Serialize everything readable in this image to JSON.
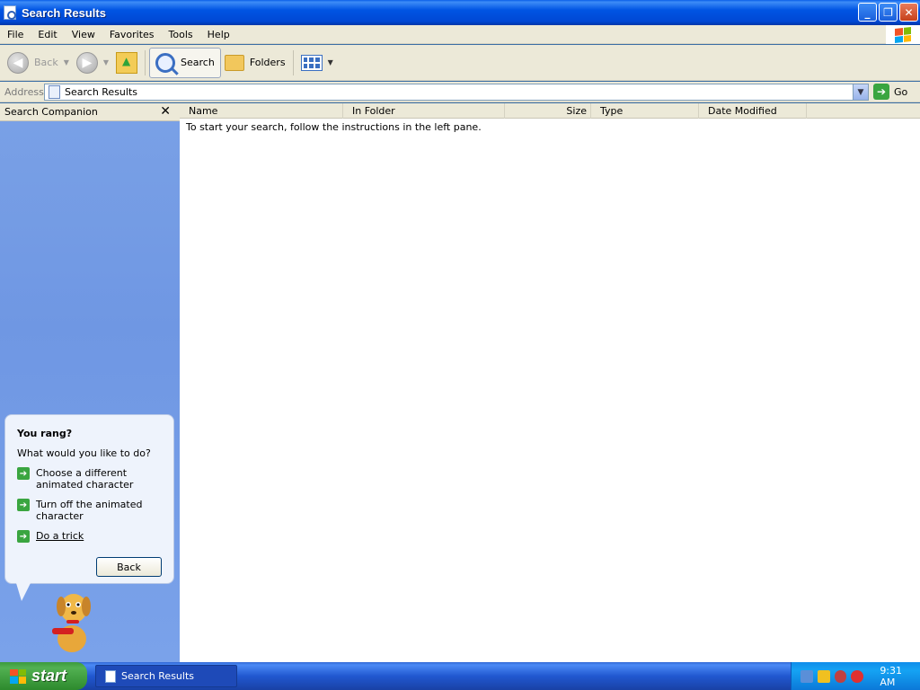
{
  "window": {
    "title": "Search Results"
  },
  "menu": [
    "File",
    "Edit",
    "View",
    "Favorites",
    "Tools",
    "Help"
  ],
  "toolbar": {
    "back": "Back",
    "search": "Search",
    "folders": "Folders"
  },
  "address": {
    "label": "Address",
    "value": "Search Results",
    "go": "Go"
  },
  "left_pane": {
    "header": "Search Companion",
    "balloon": {
      "title": "You rang?",
      "question": "What would you like to do?",
      "options": [
        "Choose a different animated character",
        "Turn off the animated character",
        "Do a trick"
      ],
      "back_button": "Back"
    }
  },
  "results": {
    "columns": [
      "Name",
      "In Folder",
      "Size",
      "Type",
      "Date Modified"
    ],
    "message": "To start your search, follow the instructions in the left pane."
  },
  "taskbar": {
    "start": "start",
    "task": "Search Results",
    "clock": "9:31 AM"
  },
  "colors": {
    "titlebar": "#0054e3",
    "left_pane": "#7aa1e6",
    "taskbar": "#2158d0",
    "start": "#3c9a3c"
  },
  "icons": [
    "back-icon",
    "forward-icon",
    "up-folder-icon",
    "search-icon",
    "folders-icon",
    "views-icon",
    "go-icon",
    "close-icon"
  ]
}
